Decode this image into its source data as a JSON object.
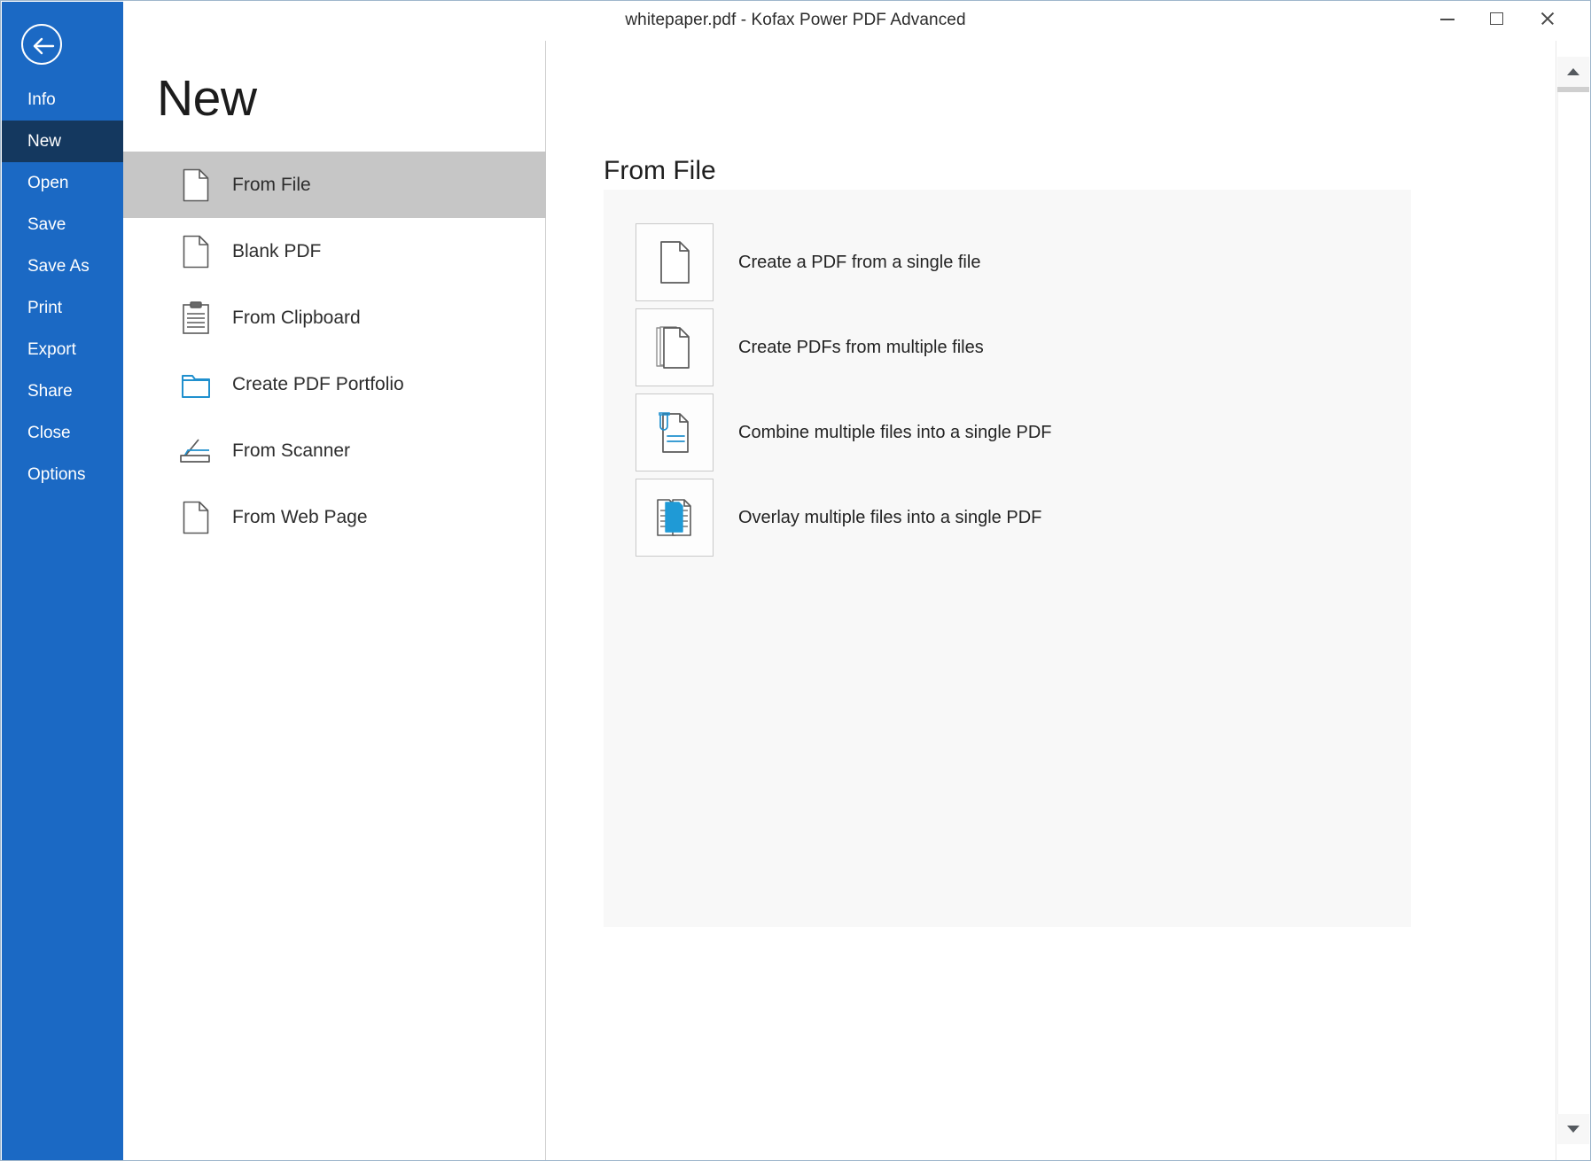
{
  "window": {
    "title": "whitepaper.pdf - Kofax Power PDF Advanced",
    "controls": {
      "minimize": "Minimize",
      "maximize": "Maximize",
      "close": "Close"
    }
  },
  "sidebar": {
    "back_label": "Back",
    "items": [
      {
        "label": "Info",
        "selected": false
      },
      {
        "label": "New",
        "selected": true
      },
      {
        "label": "Open",
        "selected": false
      },
      {
        "label": "Save",
        "selected": false
      },
      {
        "label": "Save As",
        "selected": false
      },
      {
        "label": "Print",
        "selected": false
      },
      {
        "label": "Export",
        "selected": false
      },
      {
        "label": "Share",
        "selected": false
      },
      {
        "label": "Close",
        "selected": false
      },
      {
        "label": "Options",
        "selected": false
      }
    ]
  },
  "page": {
    "heading": "New"
  },
  "source_list": {
    "items": [
      {
        "label": "From File",
        "icon": "document-icon",
        "selected": true
      },
      {
        "label": "Blank PDF",
        "icon": "document-icon",
        "selected": false
      },
      {
        "label": "From Clipboard",
        "icon": "clipboard-icon",
        "selected": false
      },
      {
        "label": "Create PDF Portfolio",
        "icon": "folder-icon",
        "selected": false
      },
      {
        "label": "From Scanner",
        "icon": "scanner-icon",
        "selected": false
      },
      {
        "label": "From Web Page",
        "icon": "document-icon",
        "selected": false
      }
    ]
  },
  "detail": {
    "title": "From File",
    "actions": [
      {
        "label": "Create a PDF from a single file",
        "icon": "single-document-icon"
      },
      {
        "label": "Create PDFs from multiple files",
        "icon": "multiple-documents-icon"
      },
      {
        "label": "Combine multiple files into a single PDF",
        "icon": "combine-documents-icon"
      },
      {
        "label": "Overlay multiple files into a single PDF",
        "icon": "overlay-documents-icon"
      }
    ]
  },
  "scrollbar": {
    "up_label": "Scroll up",
    "down_label": "Scroll down"
  },
  "colors": {
    "backstage_blue": "#1b69c4",
    "backstage_selected": "#14385f",
    "list_selected": "#c6c6c6",
    "panel_background": "#f8f8f8",
    "accent_cyan": "#1f9ad6"
  }
}
